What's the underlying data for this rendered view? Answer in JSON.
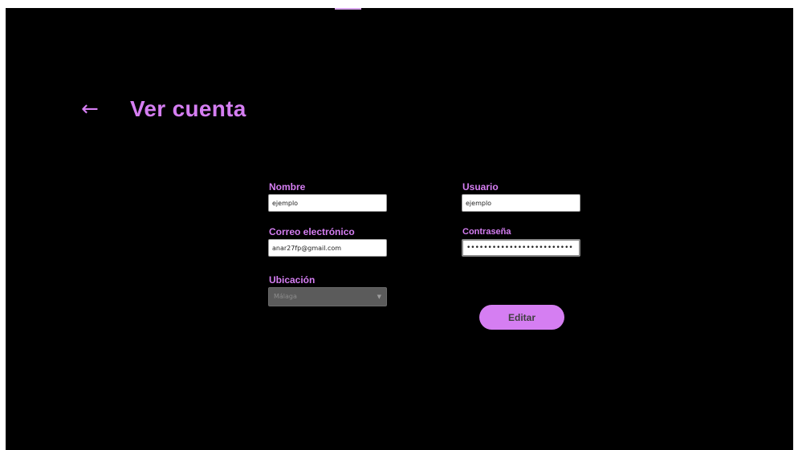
{
  "colors": {
    "background": "#000000",
    "accent": "#d57ef2",
    "input_background": "#ffffff",
    "disabled_select": "#5b5b5b",
    "button_text": "#3f3f3f"
  },
  "header": {
    "back_icon": "left-arrow-icon",
    "back_glyph": "←",
    "title": "Ver cuenta"
  },
  "form": {
    "nombre": {
      "label": "Nombre",
      "value": "ejemplo"
    },
    "usuario": {
      "label": "Usuario",
      "value": "ejemplo"
    },
    "correo": {
      "label": "Correo electrónico",
      "value": "anar27fp@gmail.com"
    },
    "contrasena": {
      "label": "Contraseña",
      "value": "•••••••••••••••••••••••••"
    },
    "ubicacion": {
      "label": "Ubicación",
      "selected": "Málaga",
      "chevron_icon": "chevron-down-icon",
      "chevron_glyph": "▼"
    }
  },
  "actions": {
    "edit_label": "Editar"
  }
}
